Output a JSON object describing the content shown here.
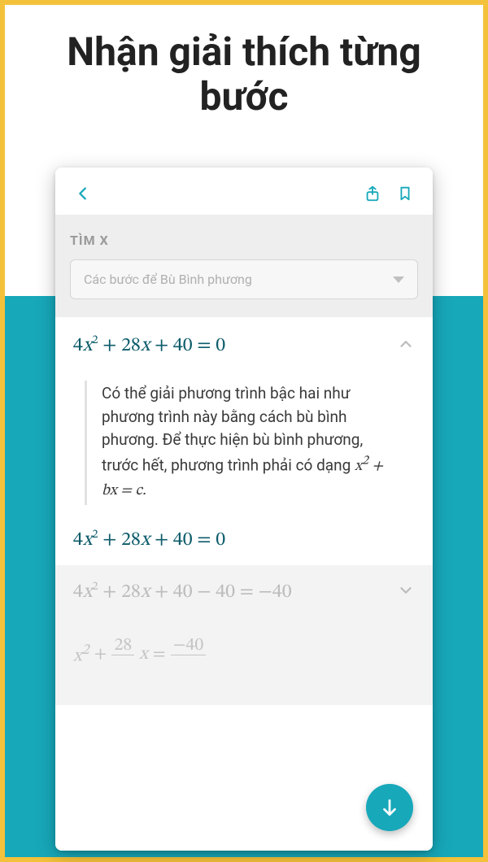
{
  "headline": "Nhận giải thích từng bước",
  "section_label": "TÌM X",
  "dropdown": {
    "selected": "Các bước để Bù Bình phương"
  },
  "step1": {
    "equation_html": "4<span class='italic'>x</span><sup>2</sup> + 28<span class='italic'>x</span> + 40 = 0",
    "explanation": "Có thể giải phương trình bậc hai như phương trình này bằng cách bù bình phương. Để thực hiện bù bình phương, trước hết, phương trình phải có dạng ",
    "explanation_math_html": "<span class='italic'>x</span><sup>2</sup> + <span class='italic'>bx</span> = <span class='italic'>c</span>."
  },
  "step2": {
    "equation_html": "4<span class='italic'>x</span><sup>2</sup> + 28<span class='italic'>x</span> + 40 = 0"
  },
  "step3": {
    "equation_html": "4<span class='italic'>x</span><sup>2</sup> + 28<span class='italic'>x</span> + 40 − 40 = −40"
  },
  "frac_row": {
    "lhs_x2": "x",
    "frac1_top": "28",
    "eq": "=",
    "frac2_top": "−40"
  }
}
